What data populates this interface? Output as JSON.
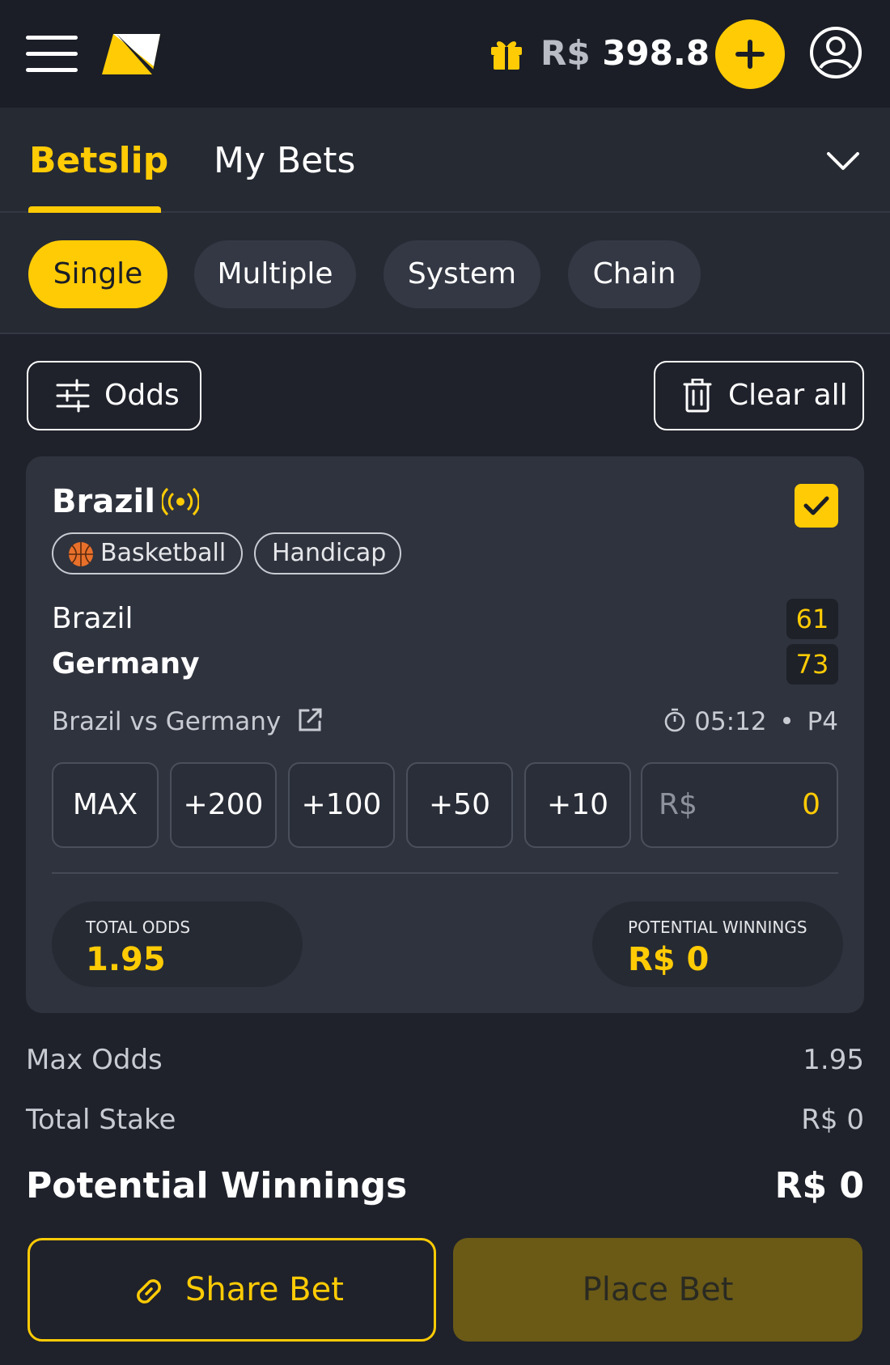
{
  "header": {
    "balance_currency": "R$",
    "balance_amount": "398.8",
    "menu_icon": "hamburger-icon",
    "gift_icon": "gift-icon",
    "deposit_icon": "plus-icon",
    "profile_icon": "user-icon"
  },
  "tabs": {
    "betslip": "Betslip",
    "my_bets": "My Bets",
    "active": "Betslip"
  },
  "bet_types": {
    "items": [
      "Single",
      "Multiple",
      "System",
      "Chain"
    ],
    "active": "Single"
  },
  "toolbar": {
    "odds_label": "Odds",
    "clear_label": "Clear all"
  },
  "selection": {
    "title": "Brazil",
    "live": true,
    "checked": true,
    "sport_tag": "Basketball",
    "market_tag": "Handicap",
    "home_team": "Brazil",
    "away_team": "Germany",
    "home_score": "61",
    "away_score": "73",
    "match_name": "Brazil vs Germany",
    "clock": "05:12",
    "period": "P4",
    "stake_presets": [
      "MAX",
      "+200",
      "+100",
      "+50",
      "+10"
    ],
    "stake_currency": "R$",
    "stake_value": "0",
    "total_odds_label": "TOTAL ODDS",
    "total_odds_value": "1.95",
    "potential_label": "POTENTIAL WINNINGS",
    "potential_value": "R$ 0"
  },
  "summary": {
    "max_odds_label": "Max Odds",
    "max_odds_value": "1.95",
    "total_stake_label": "Total Stake",
    "total_stake_value": "R$ 0",
    "potential_label": "Potential Winnings",
    "potential_value": "R$ 0"
  },
  "actions": {
    "share_label": "Share Bet",
    "place_label": "Place Bet"
  },
  "colors": {
    "accent": "#ffcb05",
    "background": "#1f222b",
    "card": "#2f333e",
    "place_disabled": "#6a5a16"
  }
}
